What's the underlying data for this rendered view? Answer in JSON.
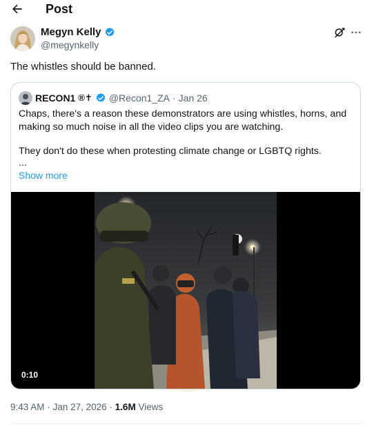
{
  "header": {
    "title": "Post",
    "back_icon": "arrow-left-icon"
  },
  "post": {
    "author": {
      "display_name": "Megyn Kelly",
      "handle": "@megynkelly",
      "verified_icon": "verified-badge-icon"
    },
    "actions": {
      "grok_icon": "grok-icon",
      "more_icon": "more-horizontal-icon"
    },
    "text": "The whistles should be banned.",
    "quote": {
      "author": {
        "display_name": "RECON1",
        "symbols": "®✝",
        "handle": "@Recon1_ZA",
        "separator": "·",
        "date": "Jan 26"
      },
      "text_lines": [
        "Chaps, there's a reason these demonstrators are using whistles, horns, and",
        "making so much noise in all the video clips you are watching.",
        "They don't do these when protesting climate change or LGBTQ rights.",
        "..."
      ],
      "show_more": "Show more",
      "video": {
        "duration": "0:10"
      }
    },
    "meta": {
      "time": "9:43 AM",
      "separator": "·",
      "date": "Jan 27, 2026",
      "views_count": "1.6M",
      "views_label": "Views"
    }
  },
  "colors": {
    "text_primary": "#0f1419",
    "text_secondary": "#536471",
    "link": "#1d9bf0",
    "border": "#cfd9de",
    "video_bg": "#000000"
  }
}
